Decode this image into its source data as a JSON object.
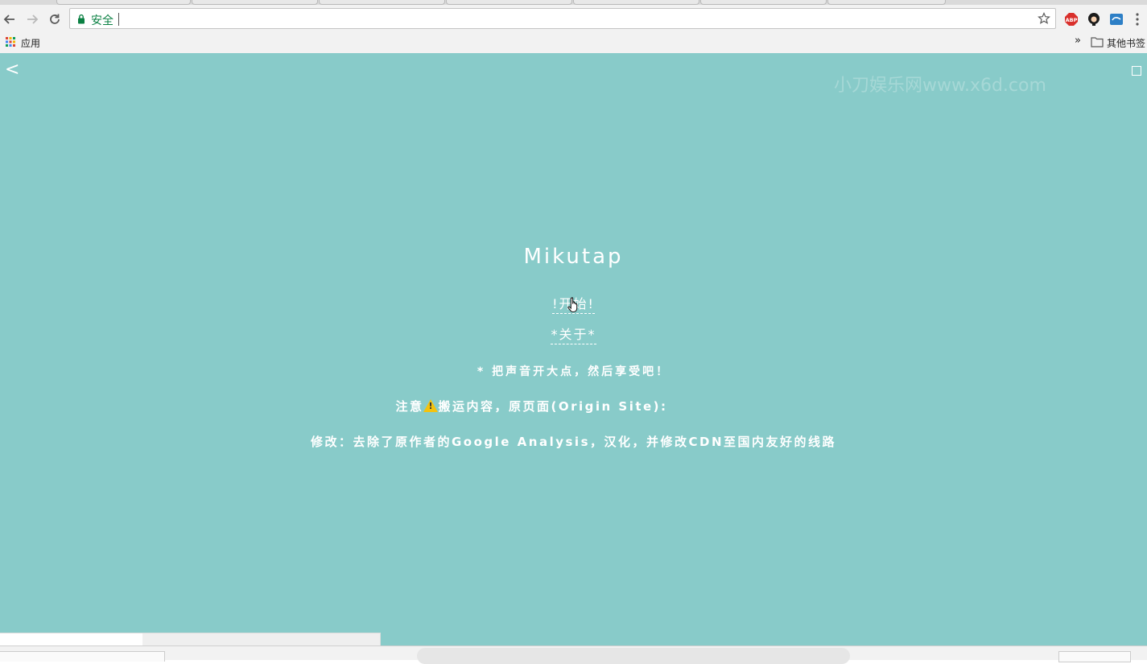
{
  "browser": {
    "security_label": "安全",
    "bookmarks": {
      "apps_label": "应用",
      "more_chevron": "»",
      "other_bookmarks_label": "其他书签"
    },
    "icons": {
      "back": "arrow-left-icon",
      "forward": "arrow-right-icon",
      "reload": "reload-icon",
      "lock": "lock-icon",
      "star": "star-icon",
      "adblock": "abp-icon",
      "extension": "avatar-extension-icon",
      "screenshot": "screenshot-extension-icon",
      "menu": "kebab-menu-icon",
      "apps": "apps-grid-icon",
      "folder": "folder-icon"
    }
  },
  "page": {
    "background_color": "#88cbc9",
    "back_label": "<",
    "watermark": "小刀娱乐网www.x6d.com",
    "title": "Mikutap",
    "start_link": "!开始!",
    "about_link": "*关于*",
    "hint": "* 把声音开大点，然后享受吧！",
    "note_prefix": "注意",
    "note_suffix": "搬运内容，原页面(Origin Site):",
    "modifications": "修改：去除了原作者的Google Analysis，汉化，并修改CDN至国内友好的线路",
    "loading_progress": 0.375
  }
}
